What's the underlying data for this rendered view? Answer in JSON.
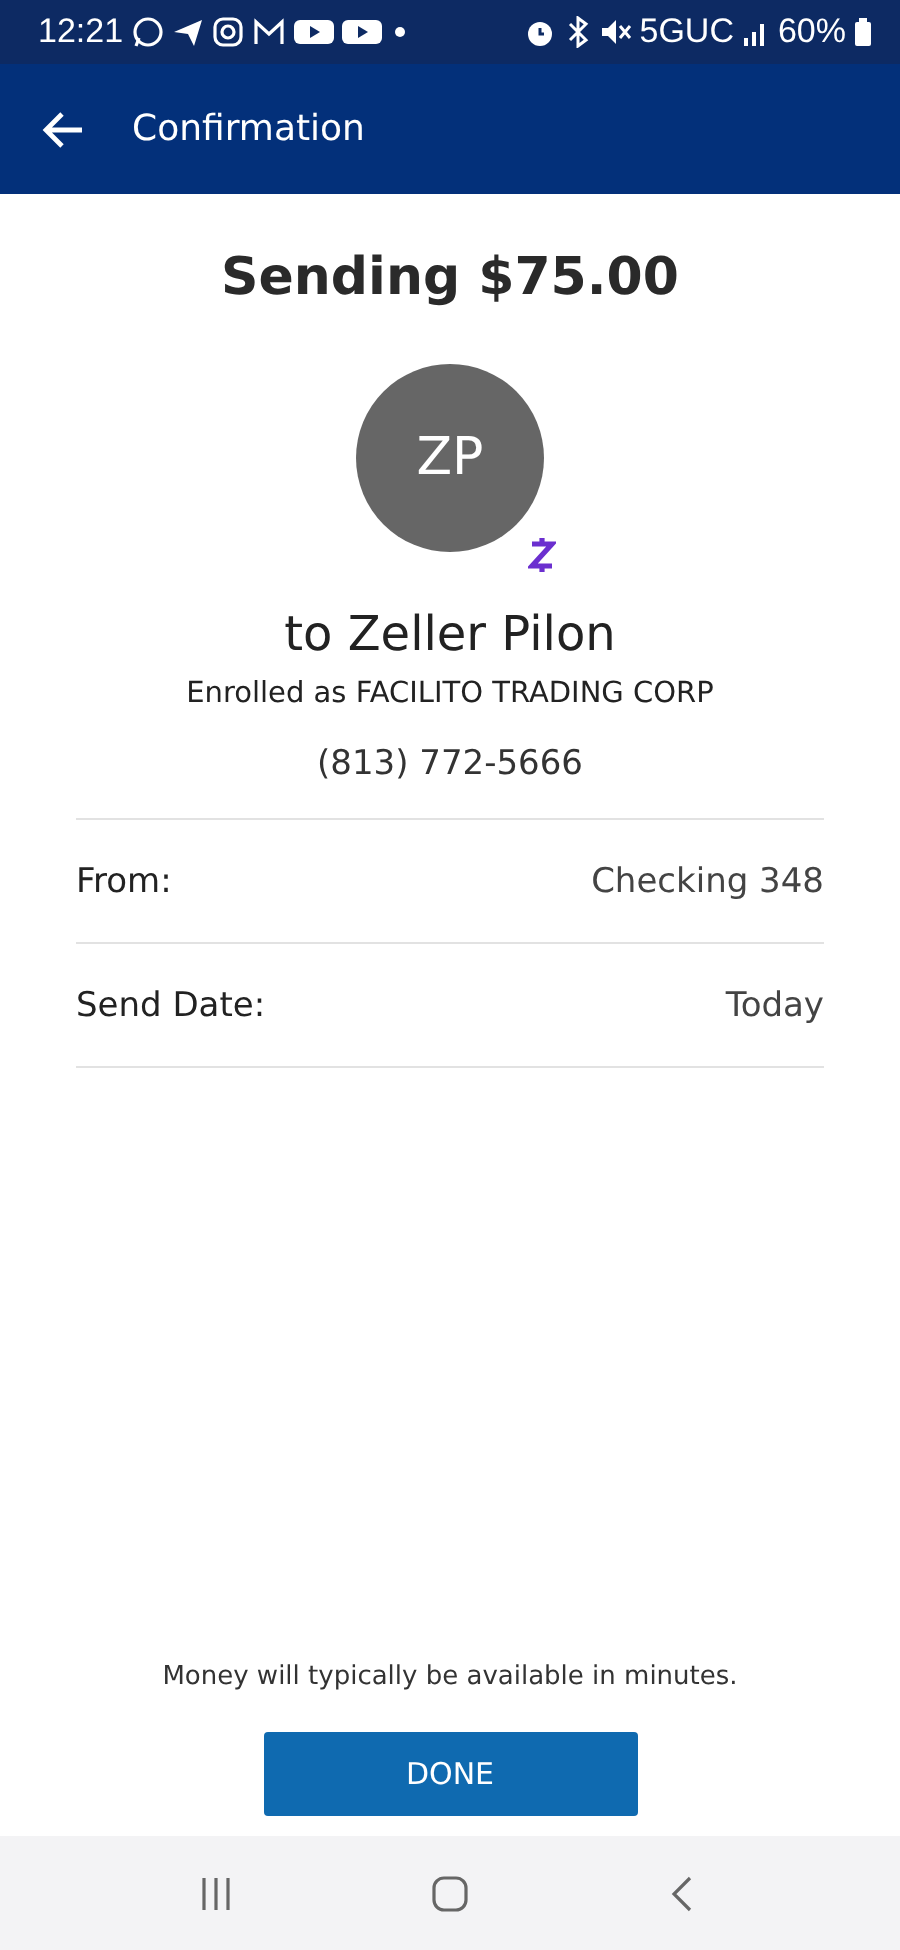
{
  "status_bar": {
    "time": "12:21",
    "network": "5GUC",
    "battery": "60%"
  },
  "header": {
    "title": "Confirmation"
  },
  "title": "Sending $75.00",
  "recipient": {
    "initials": "ZP",
    "name": "to Zeller Pilon",
    "enrolled": "Enrolled as FACILITO TRADING CORP",
    "phone": "(813) 772-5666"
  },
  "details": [
    {
      "label": "From:",
      "value": "Checking 348"
    },
    {
      "label": "Send Date:",
      "value": "Today"
    }
  ],
  "note": "Money will typically be available in minutes.",
  "button": "DONE"
}
